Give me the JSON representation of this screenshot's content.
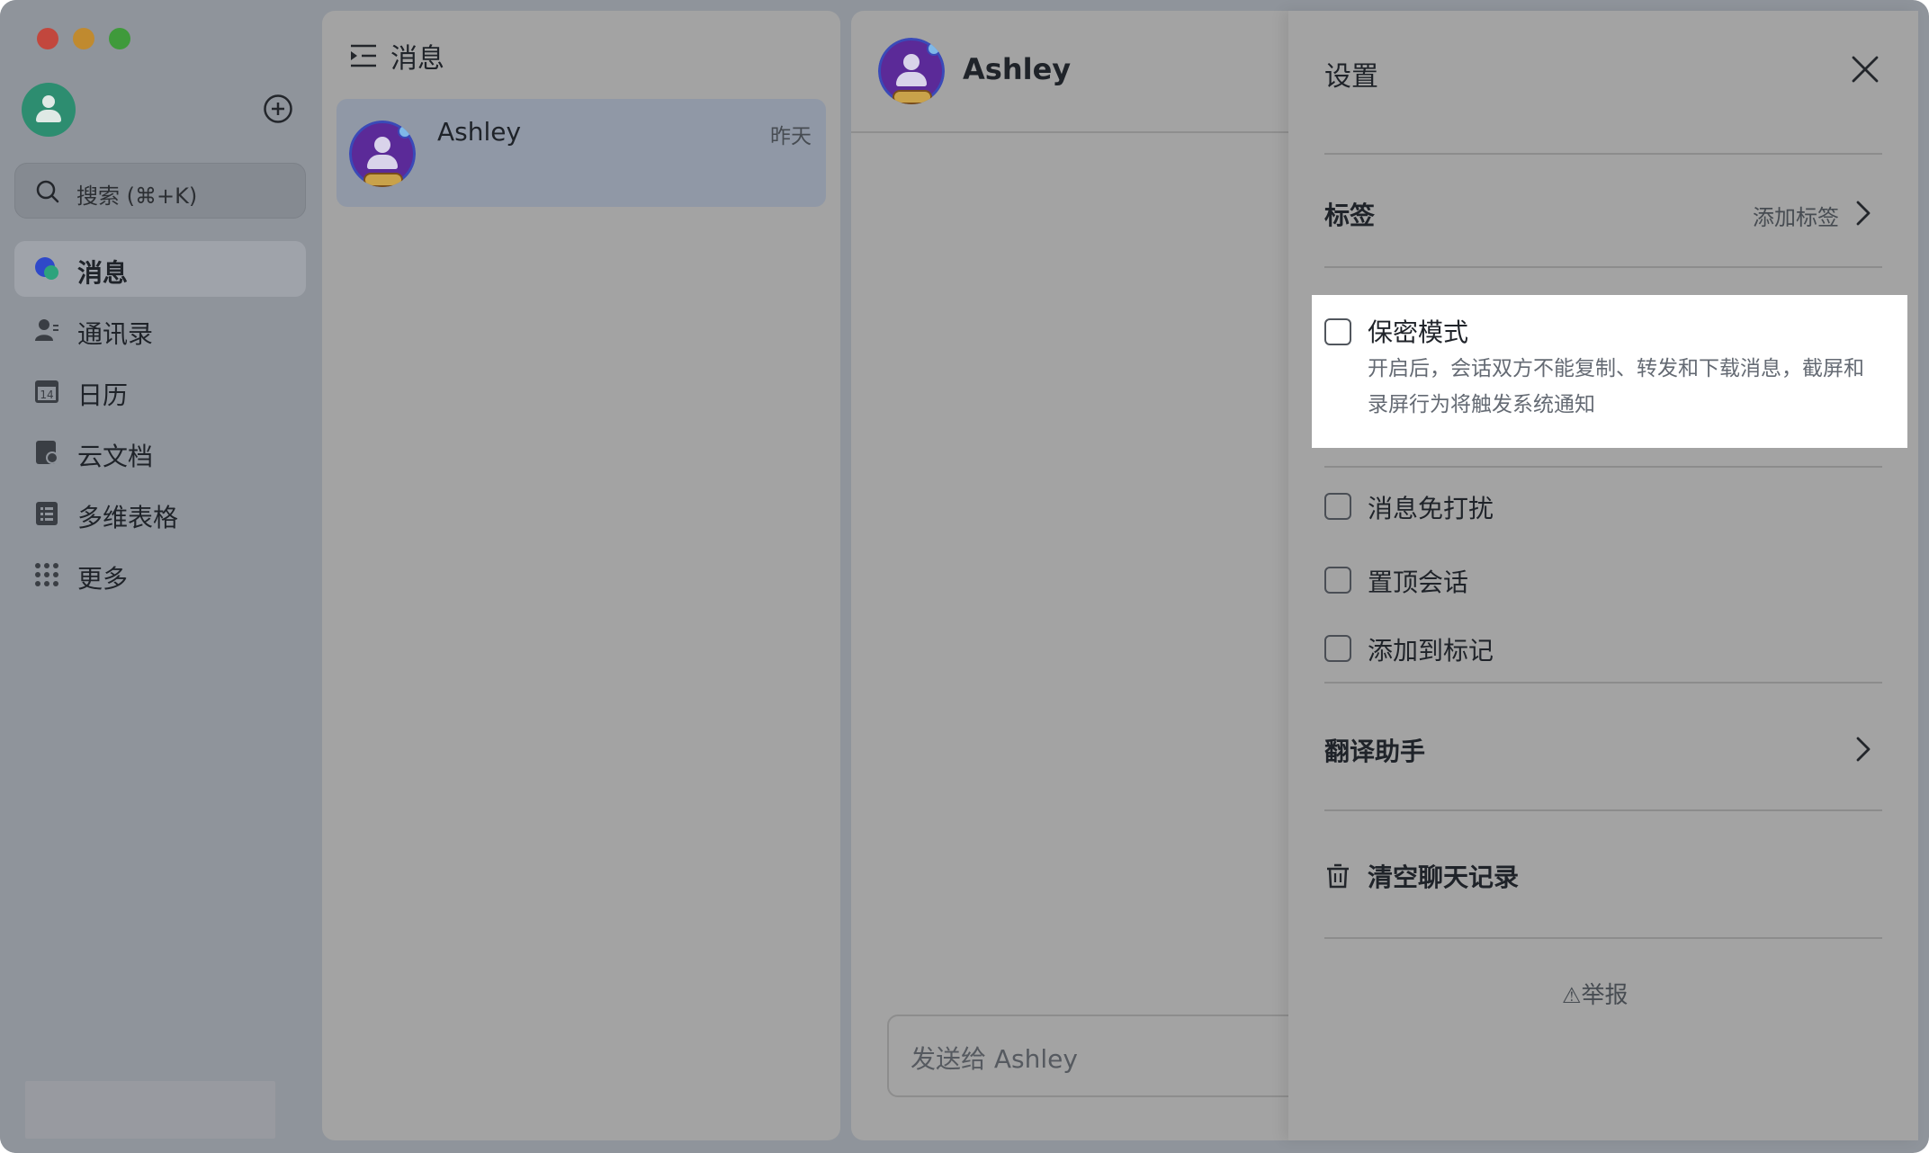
{
  "sidebar": {
    "search_placeholder": "搜索 (⌘+K)",
    "items": [
      {
        "label": "消息",
        "icon": "chat-bubble-icon"
      },
      {
        "label": "通讯录",
        "icon": "contacts-icon"
      },
      {
        "label": "日历",
        "icon": "calendar-icon",
        "icon_text": "14"
      },
      {
        "label": "云文档",
        "icon": "cloud-docs-icon"
      },
      {
        "label": "多维表格",
        "icon": "multi-table-icon"
      },
      {
        "label": "更多",
        "icon": "grid-dots-icon"
      }
    ],
    "active_index": 0
  },
  "chat_list": {
    "title": "消息",
    "items": [
      {
        "name": "Ashley",
        "time": "昨天"
      }
    ]
  },
  "conversation": {
    "name": "Ashley",
    "composer_placeholder": "发送给 Ashley"
  },
  "settings": {
    "title": "设置",
    "tags_label": "标签",
    "add_tag": "添加标签",
    "secret_mode": {
      "label": "保密模式",
      "description": "开启后，会话双方不能复制、转发和下载消息，截屏和录屏行为将触发系统通知",
      "checked": false
    },
    "mute": {
      "label": "消息免打扰",
      "checked": false
    },
    "pin": {
      "label": "置顶会话",
      "checked": false
    },
    "mark": {
      "label": "添加到标记",
      "checked": false
    },
    "translate_label": "翻译助手",
    "clear_history": "清空聊天记录",
    "report": "举报"
  },
  "colors": {
    "overlay": "#8f949b",
    "pane": "#a3a3a3",
    "highlight": "#ffffff",
    "avatar_purple": "#5b2a98",
    "me_avatar": "#2d8d70"
  }
}
